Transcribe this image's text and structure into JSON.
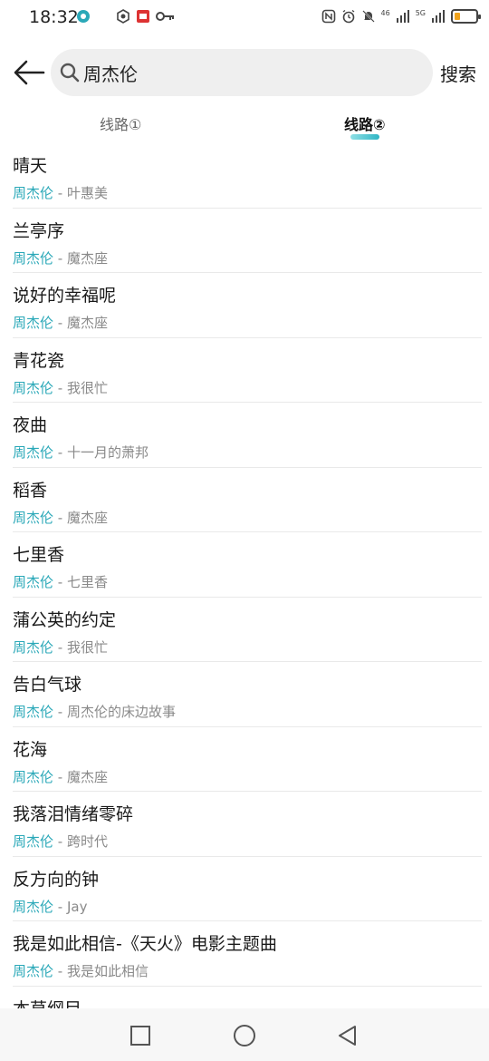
{
  "status_bar": {
    "time": "18:32",
    "battery_level": 0.25,
    "battery_color": "#f0a21a",
    "signal_1": "46",
    "signal_2": "5G"
  },
  "search": {
    "query": "周杰伦",
    "action_label": "搜索"
  },
  "tabs": [
    {
      "label": "线路①",
      "active": false
    },
    {
      "label": "线路②",
      "active": true
    }
  ],
  "songs": [
    {
      "title": "晴天",
      "artist": "周杰伦",
      "separator": " - ",
      "album": "叶惠美"
    },
    {
      "title": "兰亭序",
      "artist": "周杰伦",
      "separator": " - ",
      "album": "魔杰座"
    },
    {
      "title": "说好的幸福呢",
      "artist": "周杰伦",
      "separator": " - ",
      "album": "魔杰座"
    },
    {
      "title": "青花瓷",
      "artist": "周杰伦",
      "separator": " - ",
      "album": "我很忙"
    },
    {
      "title": "夜曲",
      "artist": "周杰伦",
      "separator": " - ",
      "album": "十一月的萧邦"
    },
    {
      "title": "稻香",
      "artist": "周杰伦",
      "separator": " - ",
      "album": "魔杰座"
    },
    {
      "title": "七里香",
      "artist": "周杰伦",
      "separator": " - ",
      "album": "七里香"
    },
    {
      "title": "蒲公英的约定",
      "artist": "周杰伦",
      "separator": " - ",
      "album": "我很忙"
    },
    {
      "title": "告白气球",
      "artist": "周杰伦",
      "separator": " - ",
      "album": "周杰伦的床边故事"
    },
    {
      "title": "花海",
      "artist": "周杰伦",
      "separator": " - ",
      "album": "魔杰座"
    },
    {
      "title": "我落泪情绪零碎",
      "artist": "周杰伦",
      "separator": " - ",
      "album": "跨时代"
    },
    {
      "title": "反方向的钟",
      "artist": "周杰伦",
      "separator": " - ",
      "album": "Jay"
    },
    {
      "title": "我是如此相信-《天火》电影主题曲",
      "artist": "周杰伦",
      "separator": " - ",
      "album": "我是如此相信"
    },
    {
      "title": "本草纲目",
      "artist": "",
      "separator": "",
      "album": ""
    }
  ],
  "colors": {
    "accent": "#2aa8b8",
    "secondary_text": "#8a8a8a"
  }
}
